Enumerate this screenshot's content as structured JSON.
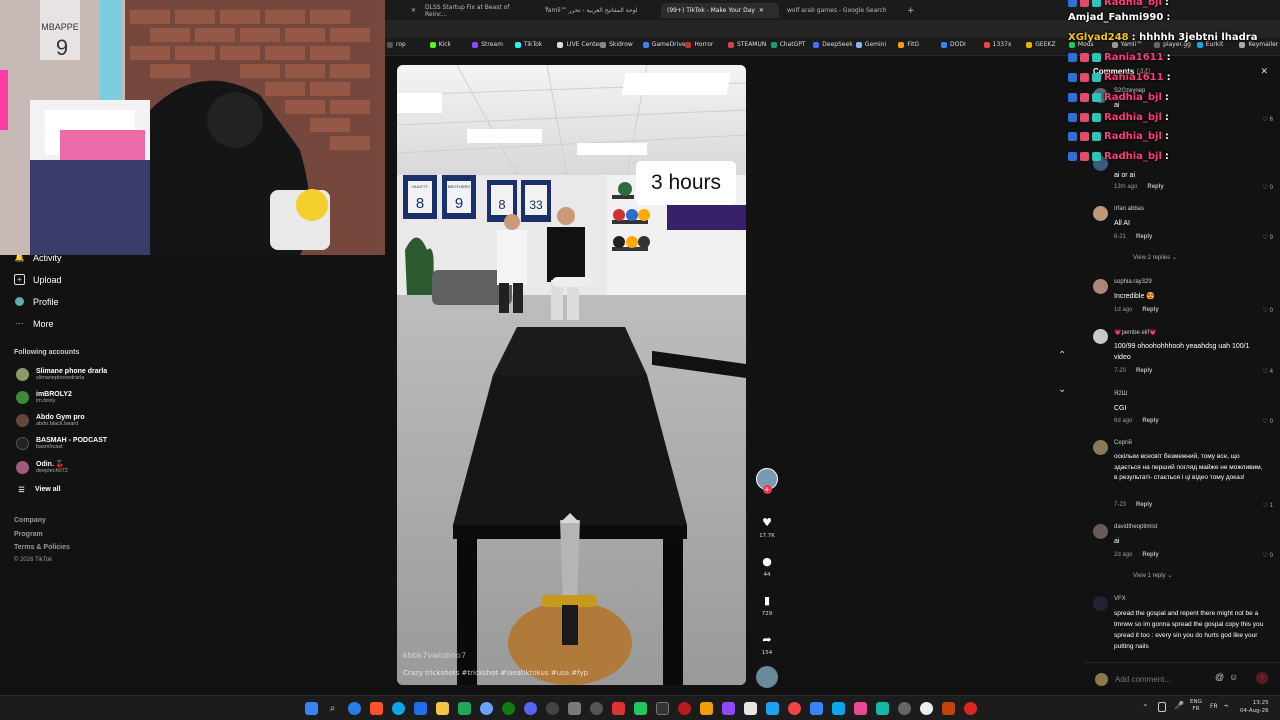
{
  "browser": {
    "tabs": [
      {
        "label": "DLSS Startup Fix at Beast of Reinc..."
      },
      {
        "label": "ٌYamli™ لوحة المفاتيح العربية - تحرر"
      },
      {
        "label": "(99+) TikTok - Make Your Day"
      },
      {
        "label": "wolf arab games - Google Search"
      }
    ],
    "bookmarks": [
      "rop",
      "Kick",
      "Stream",
      "TikTok",
      "LIVE Center",
      "Skidrow",
      "GameDrive",
      "Horror",
      "STEAMUN",
      "ChatGPT",
      "DeepSeek",
      "Gemini",
      "FitG",
      "DODI",
      "1337x",
      "GEEKZ",
      "Mods",
      "Yamli™",
      "player.gg",
      "Eurkit",
      "Keymailer"
    ]
  },
  "sidebar": {
    "nav": [
      {
        "label": "Activity",
        "icon": "bell-icon"
      },
      {
        "label": "Upload",
        "icon": "plus-square-icon"
      },
      {
        "label": "Profile",
        "icon": "person-icon"
      },
      {
        "label": "More",
        "icon": "dots-icon"
      }
    ],
    "following_title": "Following accounts",
    "following": [
      {
        "name": "Slimane phone drarla",
        "handle": "slimanephonedrarla"
      },
      {
        "name": "imBROLY2",
        "handle": "im.broly"
      },
      {
        "name": "Abdo Gym pro",
        "handle": "abdo.black.beard"
      },
      {
        "name": "BASMAH - PODCAST",
        "handle": "basmhcast"
      },
      {
        "name": "Odin. 🍒",
        "handle": "deeptech072"
      }
    ],
    "view_all": "View all",
    "footer": [
      "Company",
      "Program",
      "Terms & Policies",
      "© 2026 TikTok"
    ]
  },
  "video": {
    "overlay_text": "3 hours",
    "jerseys": [
      "8",
      "9",
      "8",
      "33"
    ],
    "jersey_names": [
      "HULETT",
      "BROTHERS",
      "",
      ""
    ],
    "watermark": "kbbk7vwlobno7",
    "caption": "Crazy trickshots #trickshot #iaeatiktokus #usa #fyp",
    "caption_display": "Crazy trickshots #trickshot #iaeatiktokus #usa #fyp"
  },
  "actions": {
    "likes": "17.7K",
    "comments": "44",
    "saves": "729",
    "shares": "154"
  },
  "comments_panel": {
    "title": "Comments",
    "count": "(44)",
    "placeholder": "Add comment...",
    "items": [
      {
        "user": "S2Gzeynep",
        "text": "ai",
        "date": "",
        "likes": "6"
      },
      {
        "user": "",
        "text": "ai or ai",
        "date": "13m ago",
        "likes": "0"
      },
      {
        "user": "Irfan abbas",
        "text": "All AI",
        "date": "6-21",
        "likes": "9"
      },
      {
        "user": "sophia.ray329",
        "text": "Incredible 😍",
        "date": "1d ago",
        "likes": "0"
      },
      {
        "user": "💗pembe elif💗",
        "text": "100/99 ohoohohhhooh yeaahdsg uah 100/1 video",
        "date": "7-20",
        "likes": "4"
      },
      {
        "user": "Я2Ш",
        "text": "CGI",
        "date": "6d ago",
        "likes": "0"
      },
      {
        "user": "Сергій",
        "text": "оскільки всесвіт безмежний, тому все, що здається на перший погляд майже не можливим, в результаті- стається і ці відео тому доказ!",
        "date": "7-23",
        "likes": "1"
      },
      {
        "user": "davidtheoptimist",
        "text": "ai",
        "date": "2d ago",
        "likes": "0"
      },
      {
        "user": "VFX",
        "text": "spread the gospal and repent there might not be a tmrww so im gonna spread the gospal copy this you spread it too : every sin you do hurts god like your putting nails",
        "date": "",
        "likes": ""
      }
    ],
    "view_replies": [
      "View 2 replies",
      "View 1 reply"
    ],
    "reply_label": "Reply"
  },
  "chat_overlay": [
    {
      "user": "Radhia_bjl",
      "text": ":"
    },
    {
      "user": "Amjad_Fahmi990",
      "text": ":"
    },
    {
      "user": "XGlyad248",
      "text": ": hhhhh 3jebtni lhadra"
    },
    {
      "user": "Rania1611",
      "text": ":"
    },
    {
      "user": "Rania1611",
      "text": ":"
    },
    {
      "user": "Radhia_bjl",
      "text": ":"
    },
    {
      "user": "Radhia_bjl",
      "text": ":"
    },
    {
      "user": "Radhia_bjl",
      "text": ":"
    },
    {
      "user": "Radhia_bjl",
      "text": ":"
    }
  ],
  "taskbar": {
    "lang": "ENG",
    "region": "FR",
    "lang2": "FR",
    "time": "13:25",
    "date": "04-Aug-26"
  },
  "colors": {
    "accent": "#fe2c55",
    "chat_name": "#ff3b7a",
    "chat_alt": "#f5c518"
  }
}
